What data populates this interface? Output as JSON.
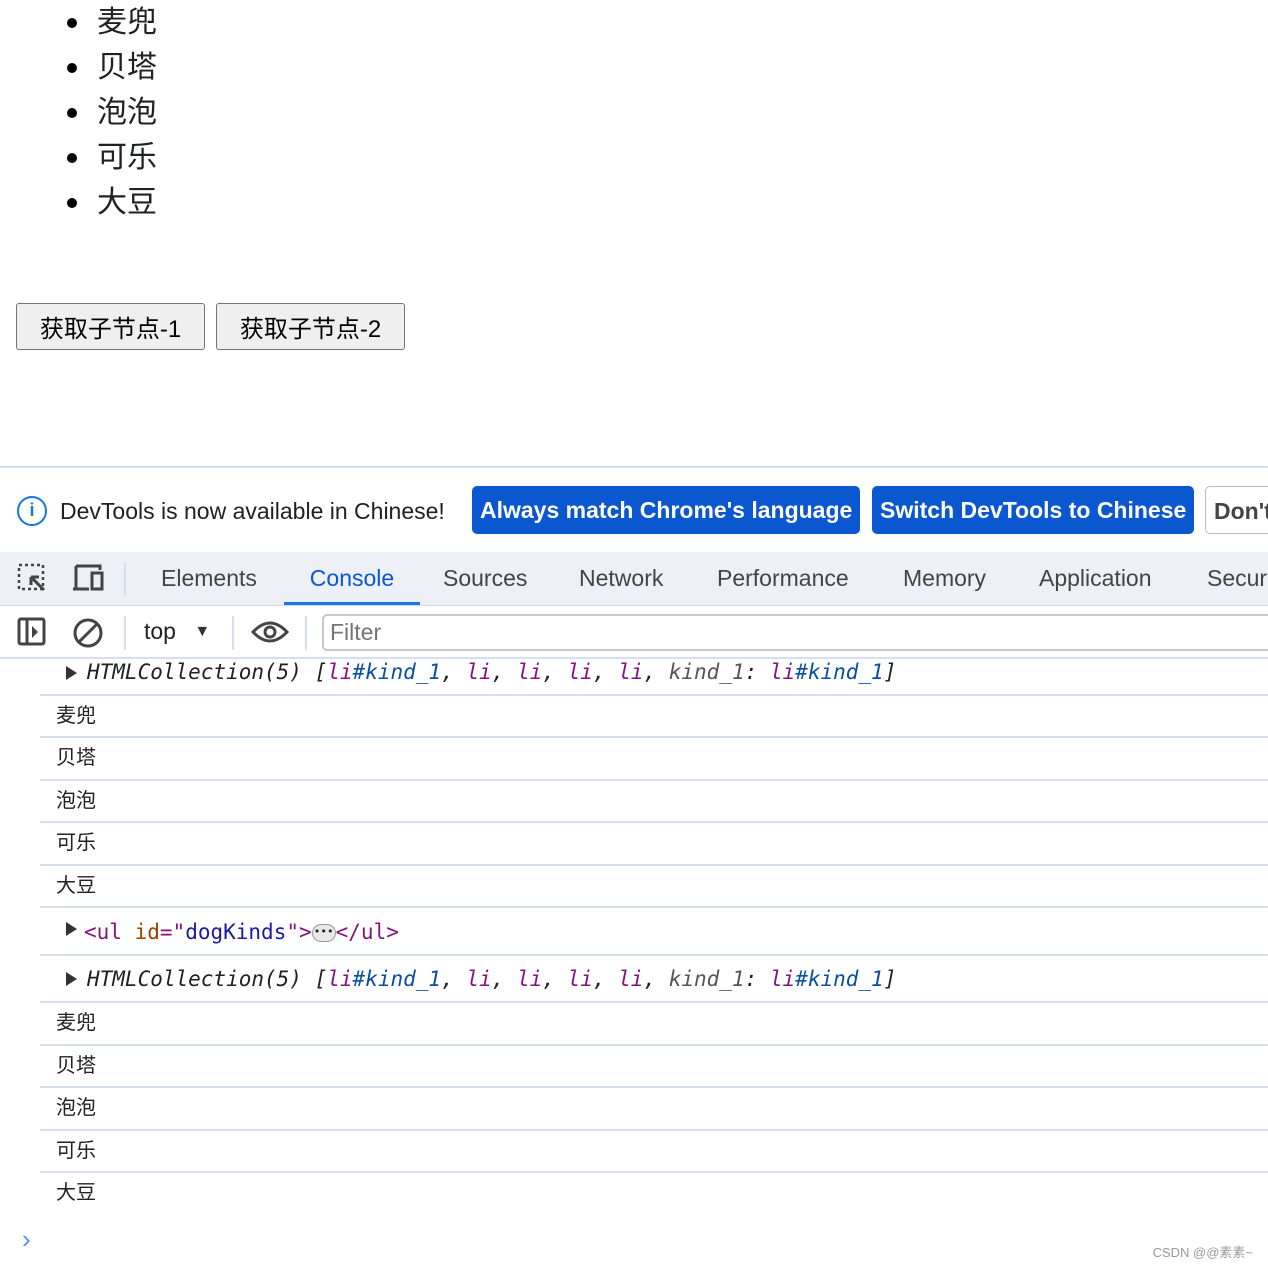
{
  "page": {
    "list": [
      "麦兜",
      "贝塔",
      "泡泡",
      "可乐",
      "大豆"
    ],
    "buttons": [
      "获取子节点-1",
      "获取子节点-2"
    ]
  },
  "infobar": {
    "message": "DevTools is now available in Chinese!",
    "btn_match": "Always match Chrome's language",
    "btn_switch": "Switch DevTools to Chinese",
    "btn_dont": "Don't"
  },
  "tabs": [
    "Elements",
    "Console",
    "Sources",
    "Network",
    "Performance",
    "Memory",
    "Application",
    "Security"
  ],
  "active_tab": "Console",
  "toolbar": {
    "context": "top",
    "filter_placeholder": "Filter"
  },
  "console": {
    "collection": {
      "label": "HTMLCollection(5)",
      "open": "[",
      "first": "li#kind_1",
      "items": [
        "li",
        "li",
        "li",
        "li"
      ],
      "key": "kind_1",
      "keyval": "li#kind_1",
      "close": "]"
    },
    "logs1": [
      "麦兜",
      "贝塔",
      "泡泡",
      "可乐",
      "大豆"
    ],
    "ul": {
      "open": "<ul",
      "attr": "id",
      "eq": "=\"",
      "val": "dogKinds",
      "end": "\">",
      "close": "</ul>"
    },
    "logs2": [
      "麦兜",
      "贝塔",
      "泡泡",
      "可乐",
      "大豆"
    ]
  },
  "watermark": "CSDN @@素素~",
  "colors": {
    "accent": "#0b57d0",
    "tag": "#881280",
    "value": "#1a1aa6"
  }
}
